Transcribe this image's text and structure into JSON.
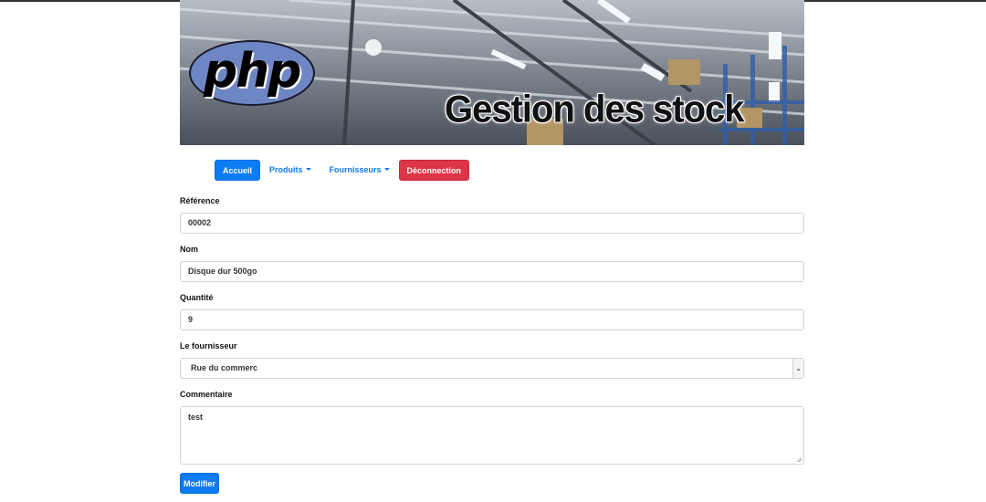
{
  "banner": {
    "logo_text": "php",
    "title": "Gestion des stock"
  },
  "nav": {
    "home": "Accueil",
    "products": "Produits",
    "suppliers": "Fournisseurs",
    "logout": "Déconnection"
  },
  "form": {
    "reference": {
      "label": "Référence",
      "value": "00002"
    },
    "name": {
      "label": "Nom",
      "value": "Disque dur 500go"
    },
    "quantity": {
      "label": "Quantité",
      "value": "9"
    },
    "supplier": {
      "label": "Le fournisseur",
      "value": "Rue du commerc"
    },
    "comment": {
      "label": "Commentaire",
      "value": "test"
    },
    "submit": "Modifier"
  },
  "colors": {
    "primary": "#0d7bf2",
    "danger": "#dc3545",
    "php_logo": "#6f86c4"
  }
}
